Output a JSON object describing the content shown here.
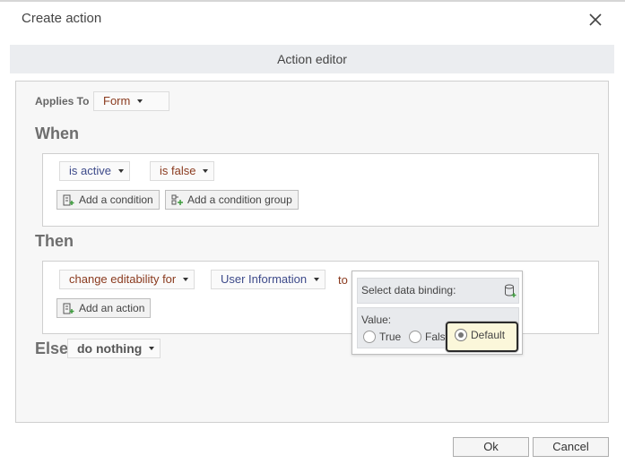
{
  "window": {
    "title": "Create action",
    "close_icon": "close-icon"
  },
  "editor": {
    "header": "Action editor"
  },
  "applies_to": {
    "label": "Applies To",
    "value": "Form"
  },
  "when": {
    "title": "When",
    "condition_subject": "is active",
    "condition_operator": "is false",
    "add_condition": "Add a condition",
    "add_condition_group": "Add a condition group"
  },
  "then": {
    "title": "Then",
    "action": "change editability for",
    "target": "User Information",
    "to_label": "to",
    "add_action": "Add an action"
  },
  "else": {
    "title": "Else",
    "action": "do nothing"
  },
  "binding_popup": {
    "title": "Select data binding:",
    "value_label": "Value:",
    "options": [
      "True",
      "False",
      "Default"
    ],
    "selected": "Default"
  },
  "footer": {
    "ok": "Ok",
    "cancel": "Cancel"
  },
  "colors": {
    "accent_text": "#8a3a1e",
    "blue_text": "#3d4a8a",
    "focus_border": "#2b2b2b"
  }
}
